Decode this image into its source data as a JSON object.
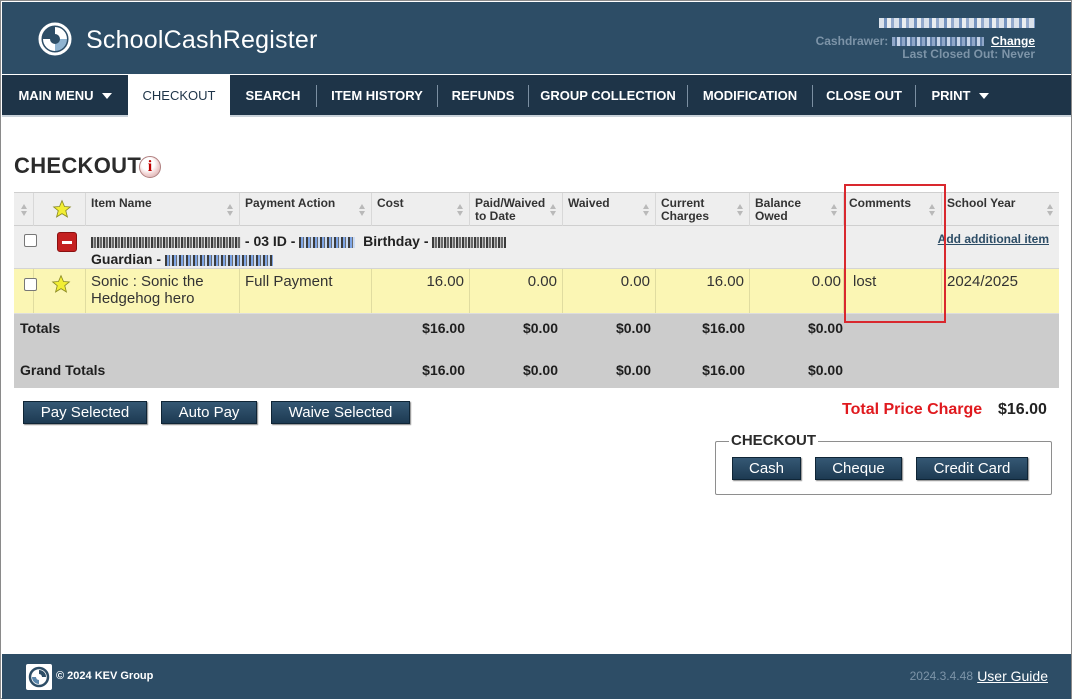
{
  "app": {
    "title": "SchoolCashRegister",
    "cashdrawer_label": "Cashdrawer:",
    "change_link": "Change",
    "last_closed_out": "Last Closed Out: Never"
  },
  "nav": {
    "items": [
      {
        "label": "MAIN MENU",
        "has_caret": true
      },
      {
        "label": "CHECKOUT",
        "active": true
      },
      {
        "label": "SEARCH"
      },
      {
        "label": "ITEM HISTORY"
      },
      {
        "label": "REFUNDS"
      },
      {
        "label": "GROUP COLLECTION"
      },
      {
        "label": "MODIFICATION"
      },
      {
        "label": "CLOSE OUT"
      },
      {
        "label": "PRINT",
        "has_caret": true
      }
    ]
  },
  "page": {
    "title": "CHECKOUT",
    "info_icon_glyph": "i"
  },
  "table": {
    "headers": [
      "Item Name",
      "Payment Action",
      "Cost",
      "Paid/Waived to Date",
      "Waived",
      "Current Charges",
      "Balance Owed",
      "Comments",
      "School Year"
    ],
    "student": {
      "grade_text": "- 03 ID -",
      "birthday_label": "Birthday -",
      "guardian_label": "Guardian -",
      "add_item_link": "Add additional item"
    },
    "rows": [
      {
        "item_name": "Sonic : Sonic the Hedgehog hero",
        "payment_action": "Full Payment",
        "cost": "16.00",
        "paid_waived": "0.00",
        "waived": "0.00",
        "current_charges": "16.00",
        "balance_owed": "0.00",
        "comments": "lost",
        "school_year": "2024/2025"
      }
    ],
    "totals": {
      "label": "Totals",
      "cost": "$16.00",
      "paid_waived": "$0.00",
      "waived": "$0.00",
      "current_charges": "$16.00",
      "balance_owed": "$0.00"
    },
    "grand_totals": {
      "label": "Grand Totals",
      "cost": "$16.00",
      "paid_waived": "$0.00",
      "waived": "$0.00",
      "current_charges": "$16.00",
      "balance_owed": "$0.00"
    }
  },
  "actions": {
    "pay_selected": "Pay Selected",
    "auto_pay": "Auto Pay",
    "waive_selected": "Waive Selected"
  },
  "price": {
    "label": "Total Price Charge",
    "value": "$16.00"
  },
  "checkout_box": {
    "legend": "CHECKOUT",
    "cash": "Cash",
    "cheque": "Cheque",
    "credit_card": "Credit Card"
  },
  "footer": {
    "copyright": "© 2024 KEV Group",
    "version": "2024.3.4.48",
    "user_guide": "User Guide"
  },
  "colors": {
    "header_bg": "#2d4d66",
    "nav_bg": "#1e3448",
    "row_highlight": "#fbf6b4",
    "totals_bg": "#cccccc",
    "price_red": "#e0191e",
    "highlight_border": "#d9282e"
  }
}
